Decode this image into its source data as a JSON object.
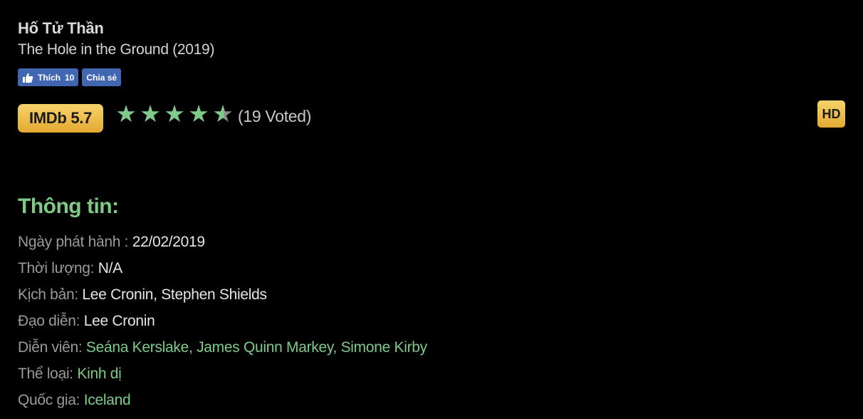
{
  "movie": {
    "title_vn": "Hố Tử Thần",
    "title_en": "The Hole in the Ground (2019)"
  },
  "facebook": {
    "like_label": "Thích",
    "like_count": "10",
    "share_label": "Chia sẻ"
  },
  "rating": {
    "imdb": "IMDb 5.7",
    "stars_filled": 4.5,
    "stars_total": 5,
    "voted": "(19 Voted)"
  },
  "quality_badge": "HD",
  "info": {
    "heading": "Thông tin:",
    "release_label": "Ngày phát hành : ",
    "release_value": "22/02/2019",
    "duration_label": "Thời lượng: ",
    "duration_value": "N/A",
    "writer_label": "Kịch bản: ",
    "writer_value": "Lee Cronin, Stephen Shields",
    "director_label": "Đạo diễn: ",
    "director_value": "Lee Cronin",
    "cast_label": "Diễn viên: ",
    "cast": [
      "Seána Kerslake",
      "James Quinn Markey",
      "Simone Kirby"
    ],
    "genre_label": "Thể loại: ",
    "genre_value": "Kinh dị",
    "country_label": "Quốc gia: ",
    "country_value": "Iceland"
  },
  "colors": {
    "accent_green": "#7dcb86",
    "badge_gold": "#f0c24a",
    "facebook_blue": "#4267b2"
  }
}
